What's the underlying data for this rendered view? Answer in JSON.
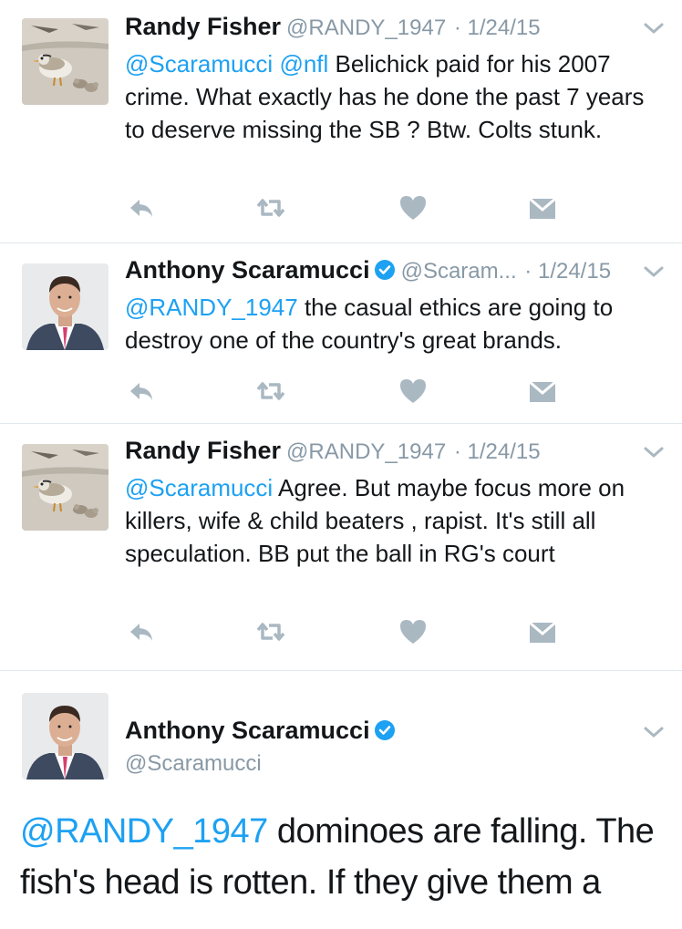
{
  "tweets": [
    {
      "name": "Randy Fisher",
      "handle": "@RANDY_1947",
      "date": "1/24/15",
      "verified": false,
      "text_parts": [
        "@Scaramucci",
        " ",
        "@nfl",
        " Belichick paid for his 2007 crime. What exactly has he done the past 7 years to deserve missing the SB ? Btw. Colts stunk."
      ]
    },
    {
      "name": "Anthony Scaramucci",
      "handle": "@Scaram...",
      "date": "1/24/15",
      "verified": true,
      "text_parts": [
        "@RANDY_1947",
        " the casual ethics are going to destroy one of the country's great brands."
      ]
    },
    {
      "name": "Randy Fisher",
      "handle": "@RANDY_1947",
      "date": "1/24/15",
      "verified": false,
      "text_parts": [
        "@Scaramucci",
        " Agree. But maybe focus more on killers, wife & child beaters , rapist. It's still all speculation. BB put the ball in RG's court"
      ]
    },
    {
      "name": "Anthony Scaramucci",
      "handle": "@Scaramucci",
      "verified": true,
      "text_parts": [
        "@RANDY_1947",
        " dominoes are falling. The fish's head is rotten. If they give them a"
      ]
    }
  ],
  "separator": " · ",
  "icons": {
    "reply": "reply-icon",
    "retweet": "retweet-icon",
    "like": "heart-icon",
    "dm": "direct-message-icon",
    "more": "chevron-down-icon",
    "verified": "verified-badge-icon"
  },
  "colors": {
    "mention": "#1da1f2",
    "muted": "#8899a6",
    "action_icons": "#aab8c2",
    "verified": "#1da1f2"
  }
}
